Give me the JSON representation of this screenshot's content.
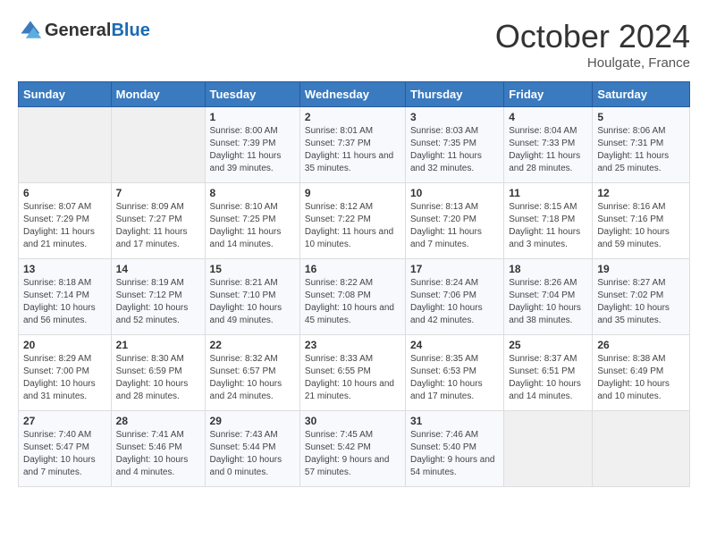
{
  "header": {
    "logo_general": "General",
    "logo_blue": "Blue",
    "month": "October 2024",
    "location": "Houlgate, France"
  },
  "weekdays": [
    "Sunday",
    "Monday",
    "Tuesday",
    "Wednesday",
    "Thursday",
    "Friday",
    "Saturday"
  ],
  "weeks": [
    [
      {
        "day": "",
        "sunrise": "",
        "sunset": "",
        "daylight": ""
      },
      {
        "day": "",
        "sunrise": "",
        "sunset": "",
        "daylight": ""
      },
      {
        "day": "1",
        "sunrise": "Sunrise: 8:00 AM",
        "sunset": "Sunset: 7:39 PM",
        "daylight": "Daylight: 11 hours and 39 minutes."
      },
      {
        "day": "2",
        "sunrise": "Sunrise: 8:01 AM",
        "sunset": "Sunset: 7:37 PM",
        "daylight": "Daylight: 11 hours and 35 minutes."
      },
      {
        "day": "3",
        "sunrise": "Sunrise: 8:03 AM",
        "sunset": "Sunset: 7:35 PM",
        "daylight": "Daylight: 11 hours and 32 minutes."
      },
      {
        "day": "4",
        "sunrise": "Sunrise: 8:04 AM",
        "sunset": "Sunset: 7:33 PM",
        "daylight": "Daylight: 11 hours and 28 minutes."
      },
      {
        "day": "5",
        "sunrise": "Sunrise: 8:06 AM",
        "sunset": "Sunset: 7:31 PM",
        "daylight": "Daylight: 11 hours and 25 minutes."
      }
    ],
    [
      {
        "day": "6",
        "sunrise": "Sunrise: 8:07 AM",
        "sunset": "Sunset: 7:29 PM",
        "daylight": "Daylight: 11 hours and 21 minutes."
      },
      {
        "day": "7",
        "sunrise": "Sunrise: 8:09 AM",
        "sunset": "Sunset: 7:27 PM",
        "daylight": "Daylight: 11 hours and 17 minutes."
      },
      {
        "day": "8",
        "sunrise": "Sunrise: 8:10 AM",
        "sunset": "Sunset: 7:25 PM",
        "daylight": "Daylight: 11 hours and 14 minutes."
      },
      {
        "day": "9",
        "sunrise": "Sunrise: 8:12 AM",
        "sunset": "Sunset: 7:22 PM",
        "daylight": "Daylight: 11 hours and 10 minutes."
      },
      {
        "day": "10",
        "sunrise": "Sunrise: 8:13 AM",
        "sunset": "Sunset: 7:20 PM",
        "daylight": "Daylight: 11 hours and 7 minutes."
      },
      {
        "day": "11",
        "sunrise": "Sunrise: 8:15 AM",
        "sunset": "Sunset: 7:18 PM",
        "daylight": "Daylight: 11 hours and 3 minutes."
      },
      {
        "day": "12",
        "sunrise": "Sunrise: 8:16 AM",
        "sunset": "Sunset: 7:16 PM",
        "daylight": "Daylight: 10 hours and 59 minutes."
      }
    ],
    [
      {
        "day": "13",
        "sunrise": "Sunrise: 8:18 AM",
        "sunset": "Sunset: 7:14 PM",
        "daylight": "Daylight: 10 hours and 56 minutes."
      },
      {
        "day": "14",
        "sunrise": "Sunrise: 8:19 AM",
        "sunset": "Sunset: 7:12 PM",
        "daylight": "Daylight: 10 hours and 52 minutes."
      },
      {
        "day": "15",
        "sunrise": "Sunrise: 8:21 AM",
        "sunset": "Sunset: 7:10 PM",
        "daylight": "Daylight: 10 hours and 49 minutes."
      },
      {
        "day": "16",
        "sunrise": "Sunrise: 8:22 AM",
        "sunset": "Sunset: 7:08 PM",
        "daylight": "Daylight: 10 hours and 45 minutes."
      },
      {
        "day": "17",
        "sunrise": "Sunrise: 8:24 AM",
        "sunset": "Sunset: 7:06 PM",
        "daylight": "Daylight: 10 hours and 42 minutes."
      },
      {
        "day": "18",
        "sunrise": "Sunrise: 8:26 AM",
        "sunset": "Sunset: 7:04 PM",
        "daylight": "Daylight: 10 hours and 38 minutes."
      },
      {
        "day": "19",
        "sunrise": "Sunrise: 8:27 AM",
        "sunset": "Sunset: 7:02 PM",
        "daylight": "Daylight: 10 hours and 35 minutes."
      }
    ],
    [
      {
        "day": "20",
        "sunrise": "Sunrise: 8:29 AM",
        "sunset": "Sunset: 7:00 PM",
        "daylight": "Daylight: 10 hours and 31 minutes."
      },
      {
        "day": "21",
        "sunrise": "Sunrise: 8:30 AM",
        "sunset": "Sunset: 6:59 PM",
        "daylight": "Daylight: 10 hours and 28 minutes."
      },
      {
        "day": "22",
        "sunrise": "Sunrise: 8:32 AM",
        "sunset": "Sunset: 6:57 PM",
        "daylight": "Daylight: 10 hours and 24 minutes."
      },
      {
        "day": "23",
        "sunrise": "Sunrise: 8:33 AM",
        "sunset": "Sunset: 6:55 PM",
        "daylight": "Daylight: 10 hours and 21 minutes."
      },
      {
        "day": "24",
        "sunrise": "Sunrise: 8:35 AM",
        "sunset": "Sunset: 6:53 PM",
        "daylight": "Daylight: 10 hours and 17 minutes."
      },
      {
        "day": "25",
        "sunrise": "Sunrise: 8:37 AM",
        "sunset": "Sunset: 6:51 PM",
        "daylight": "Daylight: 10 hours and 14 minutes."
      },
      {
        "day": "26",
        "sunrise": "Sunrise: 8:38 AM",
        "sunset": "Sunset: 6:49 PM",
        "daylight": "Daylight: 10 hours and 10 minutes."
      }
    ],
    [
      {
        "day": "27",
        "sunrise": "Sunrise: 7:40 AM",
        "sunset": "Sunset: 5:47 PM",
        "daylight": "Daylight: 10 hours and 7 minutes."
      },
      {
        "day": "28",
        "sunrise": "Sunrise: 7:41 AM",
        "sunset": "Sunset: 5:46 PM",
        "daylight": "Daylight: 10 hours and 4 minutes."
      },
      {
        "day": "29",
        "sunrise": "Sunrise: 7:43 AM",
        "sunset": "Sunset: 5:44 PM",
        "daylight": "Daylight: 10 hours and 0 minutes."
      },
      {
        "day": "30",
        "sunrise": "Sunrise: 7:45 AM",
        "sunset": "Sunset: 5:42 PM",
        "daylight": "Daylight: 9 hours and 57 minutes."
      },
      {
        "day": "31",
        "sunrise": "Sunrise: 7:46 AM",
        "sunset": "Sunset: 5:40 PM",
        "daylight": "Daylight: 9 hours and 54 minutes."
      },
      {
        "day": "",
        "sunrise": "",
        "sunset": "",
        "daylight": ""
      },
      {
        "day": "",
        "sunrise": "",
        "sunset": "",
        "daylight": ""
      }
    ]
  ]
}
